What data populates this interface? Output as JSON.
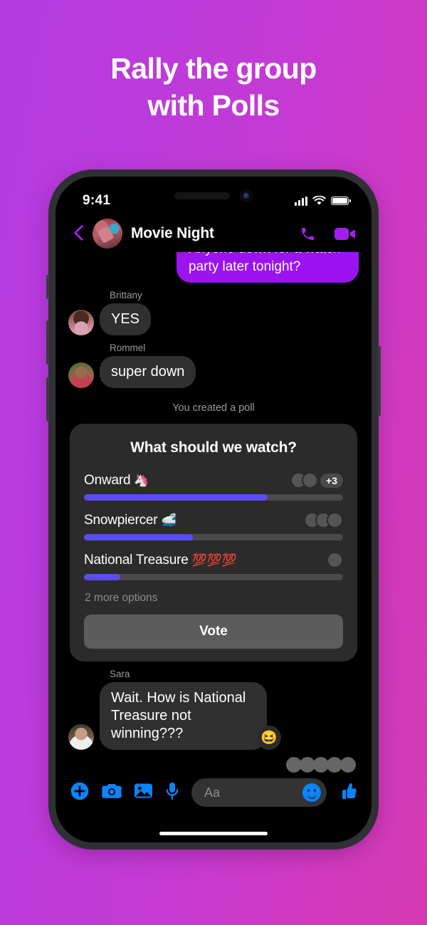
{
  "headline": {
    "line1": "Rally the group",
    "line2": "with Polls"
  },
  "status_bar": {
    "time": "9:41",
    "signal_icon": "cellular-bars-icon",
    "wifi_icon": "wifi-icon",
    "battery_icon": "battery-icon"
  },
  "chat_header": {
    "back_icon": "back-chevron-icon",
    "title": "Movie Night",
    "call_icon": "phone-call-icon",
    "video_icon": "video-call-icon"
  },
  "messages": [
    {
      "type": "outgoing",
      "text": "Anyone down for a watch party later tonight?"
    },
    {
      "type": "incoming",
      "sender": "Brittany",
      "text": "YES"
    },
    {
      "type": "incoming",
      "sender": "Rommel",
      "text": "super down"
    }
  ],
  "poll": {
    "system_note": "You created a poll",
    "title": "What should we watch?",
    "options": [
      {
        "label": "Onward",
        "emoji": "🦄",
        "percent": 71,
        "voter_count": 5,
        "extra_badge": "+3",
        "avatars": 2
      },
      {
        "label": "Snowpiercer",
        "emoji": "🚅",
        "percent": 42,
        "voter_count": 3,
        "extra_badge": "",
        "avatars": 3
      },
      {
        "label": "National Treasure",
        "emoji": "💯💯💯",
        "percent": 14,
        "voter_count": 1,
        "extra_badge": "",
        "avatars": 1
      }
    ],
    "more_options": "2 more options",
    "vote_label": "Vote",
    "fill_color": "#5a4bf2",
    "track_color": "#4a4a4a"
  },
  "last_message": {
    "sender": "Sara",
    "text": "Wait. How is National Treasure not winning???",
    "reaction": "😆"
  },
  "seen_by_count": 5,
  "input_bar": {
    "plus_icon": "plus-circle-icon",
    "camera_icon": "camera-icon",
    "gallery_icon": "photo-gallery-icon",
    "mic_icon": "microphone-icon",
    "placeholder": "Aa",
    "emoji_icon": "smiley-icon",
    "like_icon": "thumbs-up-icon",
    "accent_color": "#0a84ff"
  },
  "theme": {
    "bg_gradient_start": "#b23ce0",
    "bg_gradient_end": "#d43bb2",
    "outgoing_bubble": "#9b13f0",
    "incoming_bubble": "#303030",
    "header_accent": "#a31ff0"
  }
}
